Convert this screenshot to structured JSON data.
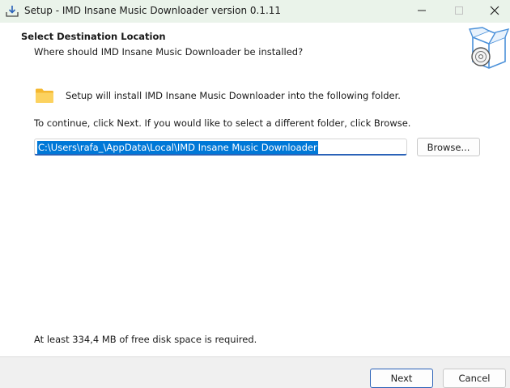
{
  "window": {
    "title": "Setup - IMD Insane Music Downloader version 0.1.11",
    "app_icon": "installer-download-icon",
    "controls": {
      "minimize_icon": "minimize-icon",
      "maximize_icon": "maximize-icon",
      "close_icon": "close-icon"
    }
  },
  "header": {
    "title": "Select Destination Location",
    "subtitle": "Where should IMD Insane Music Downloader be installed?",
    "icon": "box-with-disc-icon"
  },
  "content": {
    "folder_icon": "folder-icon",
    "install_text": "Setup will install IMD Insane Music Downloader into the following folder.",
    "continue_text": "To continue, click Next. If you would like to select a different folder, click Browse.",
    "path_value": "C:\\Users\\rafa_\\AppData\\Local\\IMD Insane Music Downloader",
    "browse_label": "Browse...",
    "disk_space_text": "At least 334,4 MB of free disk space is required."
  },
  "footer": {
    "next_label": "Next",
    "cancel_label": "Cancel"
  },
  "colors": {
    "titlebar_bg": "#eaf3ea",
    "selection_bg": "#0078d7",
    "accent": "#2a62b8",
    "folder_yellow": "#f8c84a"
  }
}
